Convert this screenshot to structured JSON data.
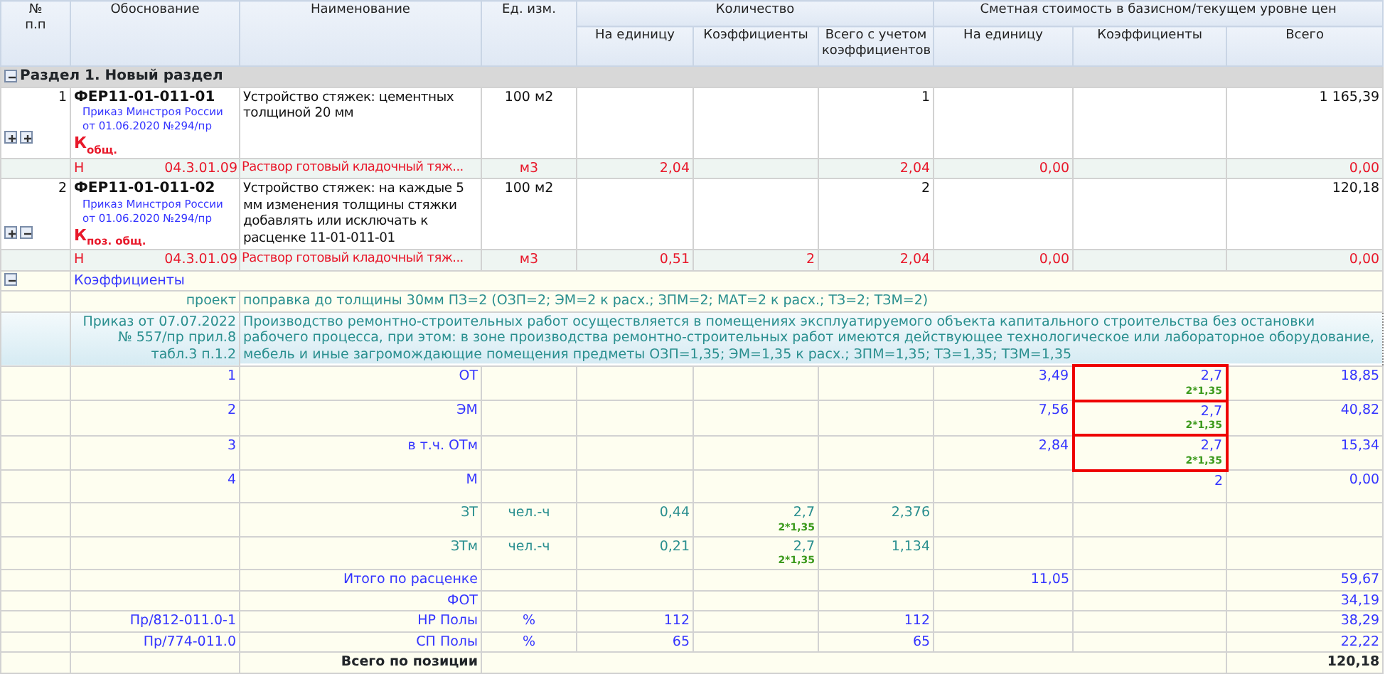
{
  "columns": [
    {
      "label": "№\nп.п"
    },
    {
      "label": "Обоснование"
    },
    {
      "label": "Наименование"
    },
    {
      "label": "Ед. изм."
    },
    {
      "label": "Количество",
      "children": [
        {
          "label": "На единицу"
        },
        {
          "label": "Коэффициенты"
        },
        {
          "label": "Всего с учетом коэффициентов"
        }
      ]
    },
    {
      "label": "Сметная стоимость в базисном/текущем уровне цен",
      "children": [
        {
          "label": "На единицу"
        },
        {
          "label": "Коэффициенты"
        },
        {
          "label": "Всего"
        }
      ]
    }
  ],
  "section": {
    "title": "Раздел 1. Новый раздел",
    "expanded": true
  },
  "rows": [
    {
      "kind": "position",
      "number": "1",
      "code": "ФЕР11-01-011-01",
      "source": "Приказ Минстроя России от 01.06.2020 №294/пр",
      "coef_mark": "К$_{общ.}$",
      "toggles": [
        {
          "expanded": false
        },
        {
          "expanded": false
        }
      ],
      "name": "Устройство стяжек: цементных толщиной 20 мм",
      "unit": "100 м2",
      "qty_total": "1",
      "cost_total": "1 165,39"
    },
    {
      "kind": "resource",
      "type": "Н",
      "code": "04.3.01.09",
      "cells": {
        "name": "Раствор готовый кладочный тяж...",
        "unit": "м3",
        "qty_unit": "2,04",
        "qty_total": "2,04",
        "cost_unit": "0,00",
        "cost_total": "0,00"
      }
    },
    {
      "kind": "position",
      "number": "2",
      "code": "ФЕР11-01-011-02",
      "source": "Приказ Минстроя России от 01.06.2020 №294/пр",
      "coef_mark": "К$_{поз. общ.}$",
      "toggles": [
        {
          "expanded": false
        },
        {
          "expanded": true
        }
      ],
      "name": "Устройство стяжек: на каждые 5 мм изменения толщины стяжки добавлять или исключать к расценке 11-01-011-01",
      "unit": "100 м2",
      "qty_total": "2",
      "cost_total": "120,18"
    },
    {
      "kind": "resource",
      "type": "Н",
      "code": "04.3.01.09",
      "cells": {
        "name": "Раствор готовый кладочный тяж...",
        "unit": "м3",
        "qty_unit": "0,51",
        "qty_coef": "2",
        "qty_total": "2,04",
        "cost_unit": "0,00",
        "cost_total": "0,00"
      }
    },
    {
      "kind": "coef_group",
      "label": "Коэффициенты",
      "expanded": true
    },
    {
      "kind": "coef_project",
      "source": "проект",
      "text": "поправка до толщины 30мм ПЗ=2 (ОЗП=2; ЭМ=2 к расх.; ЗПМ=2; МАТ=2 к расх.; ТЗ=2; ТЗМ=2)"
    },
    {
      "kind": "coef_order",
      "source": "Приказ от 07.07.2022 № 557/пр прил.8 табл.3 п.1.2",
      "text": "Производство ремонтно-строительных работ осуществляется в помещениях эксплуатируемого объекта капитального строительства без остановки рабочего процесса, при этом: в зоне производства ремонтно-строительных работ имеются действующее технологическое или лабораторное оборудование, мебель и иные загромождающие помещения предметы ОЗП=1,35; ЭМ=1,35 к расх.; ЗПМ=1,35; ТЗ=1,35; ТЗМ=1,35"
    },
    {
      "kind": "cost",
      "cells": {
        "basis": "1",
        "name": "ОТ",
        "cost_unit": "3,49",
        "cost_coef": {
          "text": "2,7",
          "formula": "2*1,35",
          "highlighted": true
        },
        "cost_total": "18,85"
      }
    },
    {
      "kind": "cost",
      "cells": {
        "basis": "2",
        "name": "ЭМ",
        "cost_unit": "7,56",
        "cost_coef": {
          "text": "2,7",
          "formula": "2*1,35",
          "highlighted": true
        },
        "cost_total": "40,82"
      }
    },
    {
      "kind": "cost",
      "cells": {
        "basis": "3",
        "name": "в т.ч. ОТм",
        "cost_unit": "2,84",
        "cost_coef": {
          "text": "2,7",
          "formula": "2*1,35",
          "highlighted": true
        },
        "cost_total": "15,34"
      }
    },
    {
      "kind": "cost",
      "cells": {
        "basis": "4",
        "name": "М",
        "cost_coef": {
          "text": "2",
          "highlighted": false
        },
        "cost_total": "0,00"
      }
    },
    {
      "kind": "labor",
      "cells": {
        "name": "ЗТ",
        "unit": "чел.-ч",
        "qty_unit": "0,44",
        "qty_coef": {
          "text": "2,7",
          "formula": "2*1,35"
        },
        "qty_total": "2,376"
      }
    },
    {
      "kind": "labor",
      "cells": {
        "name": "ЗТм",
        "unit": "чел.-ч",
        "qty_unit": "0,21",
        "qty_coef": {
          "text": "2,7",
          "formula": "2*1,35"
        },
        "qty_total": "1,134"
      }
    },
    {
      "kind": "subtotal",
      "cells": {
        "name": "Итого по расценке",
        "cost_unit": "11,05",
        "cost_total": "59,67"
      }
    },
    {
      "kind": "subtotal",
      "cells": {
        "name": "ФОТ",
        "cost_total": "34,19"
      }
    },
    {
      "kind": "subtotal",
      "cells": {
        "basis": "Пр/812-011.0-1",
        "name": "НР Полы",
        "unit": "%",
        "qty_unit": "112",
        "qty_total": "112",
        "cost_total": "38,29"
      }
    },
    {
      "kind": "subtotal",
      "cells": {
        "basis": "Пр/774-011.0",
        "name": "СП Полы",
        "unit": "%",
        "qty_unit": "65",
        "qty_total": "65",
        "cost_total": "22,22"
      }
    },
    {
      "kind": "total",
      "name": "Всего по позиции",
      "cost_total": "120,18"
    }
  ]
}
